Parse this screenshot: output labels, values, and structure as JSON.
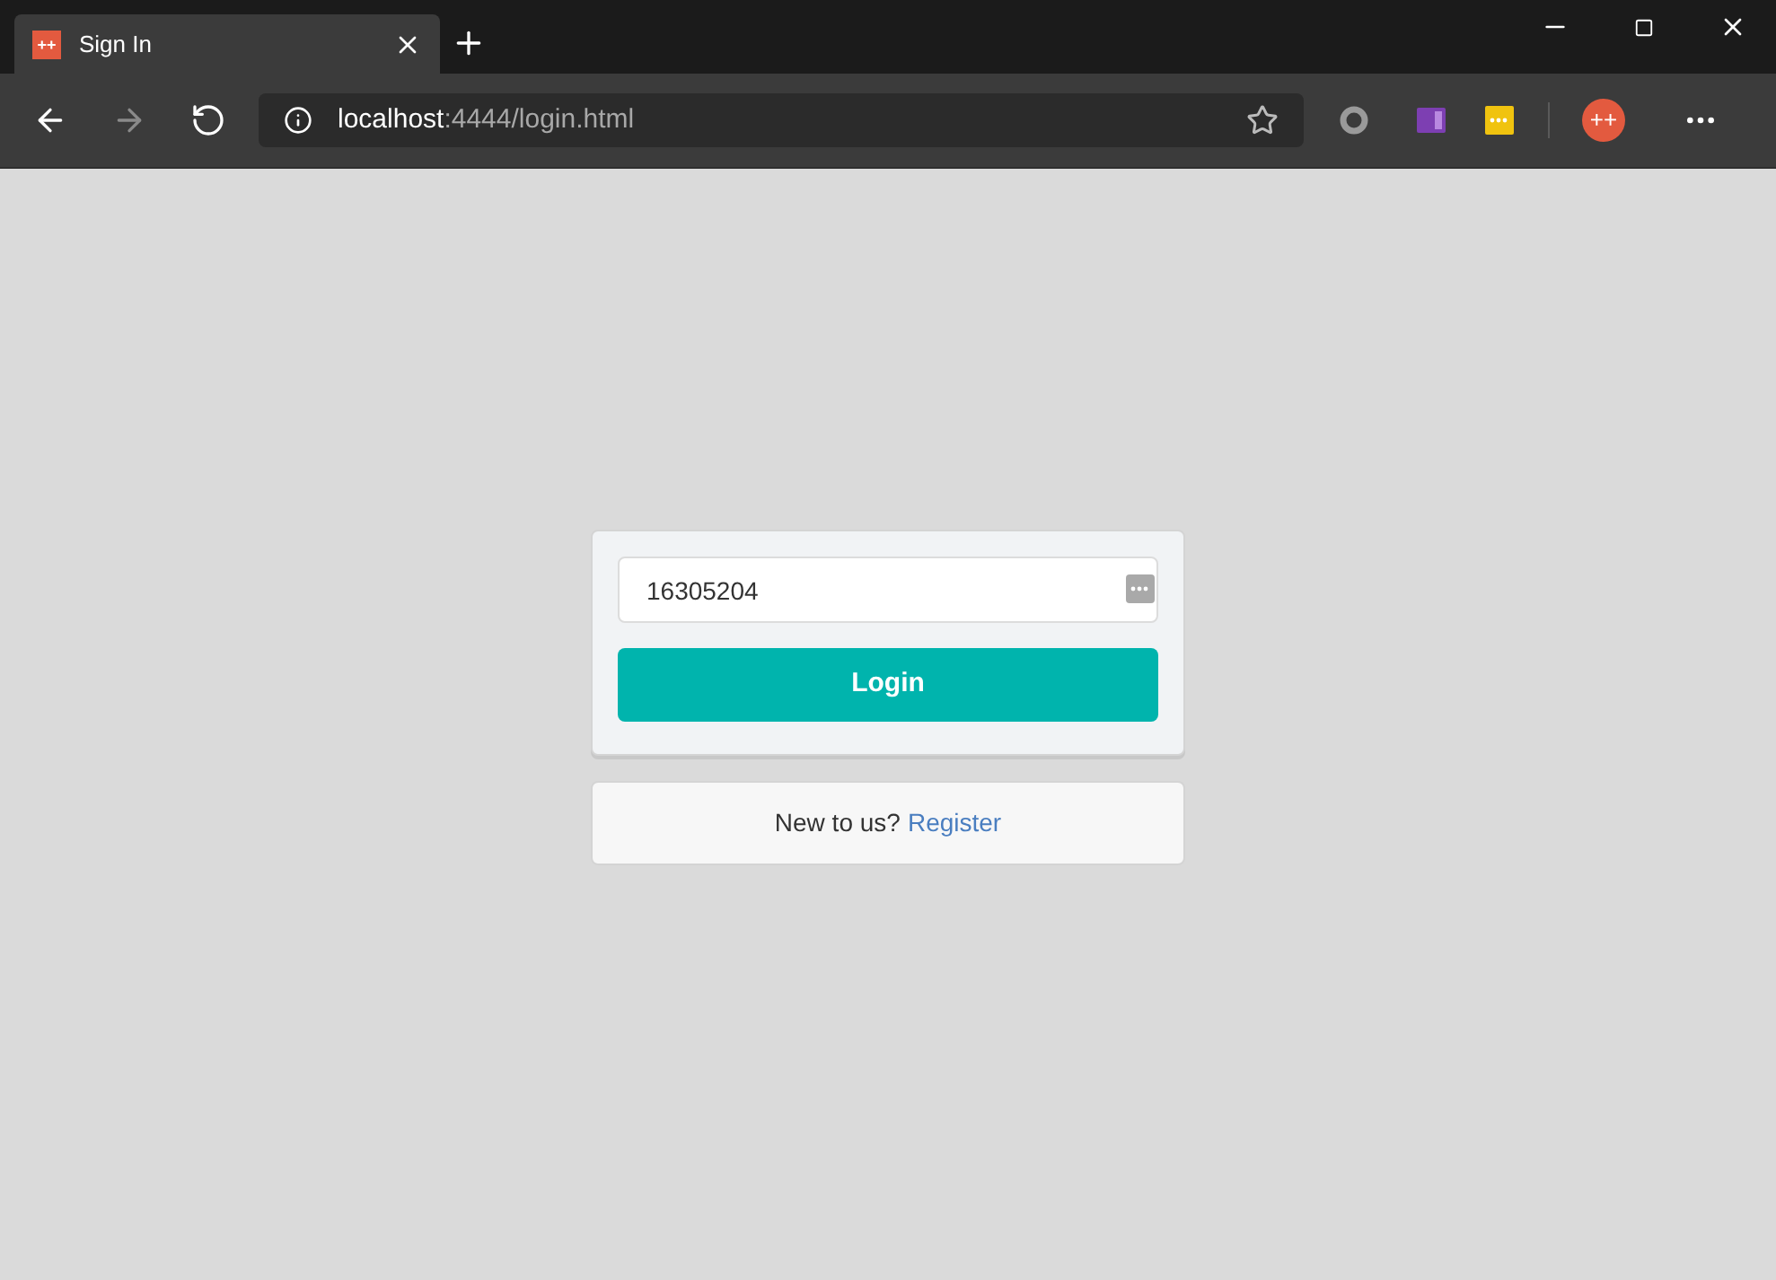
{
  "tab": {
    "favicon_text": "++",
    "title": "Sign In",
    "selected": true
  },
  "address_bar": {
    "host": "localhost",
    "path": ":4444/login.html"
  },
  "extension_badge": "++",
  "login_form": {
    "username": "16305204",
    "button": "Login"
  },
  "register_prompt": {
    "text": "New to us?",
    "link": "Register"
  }
}
